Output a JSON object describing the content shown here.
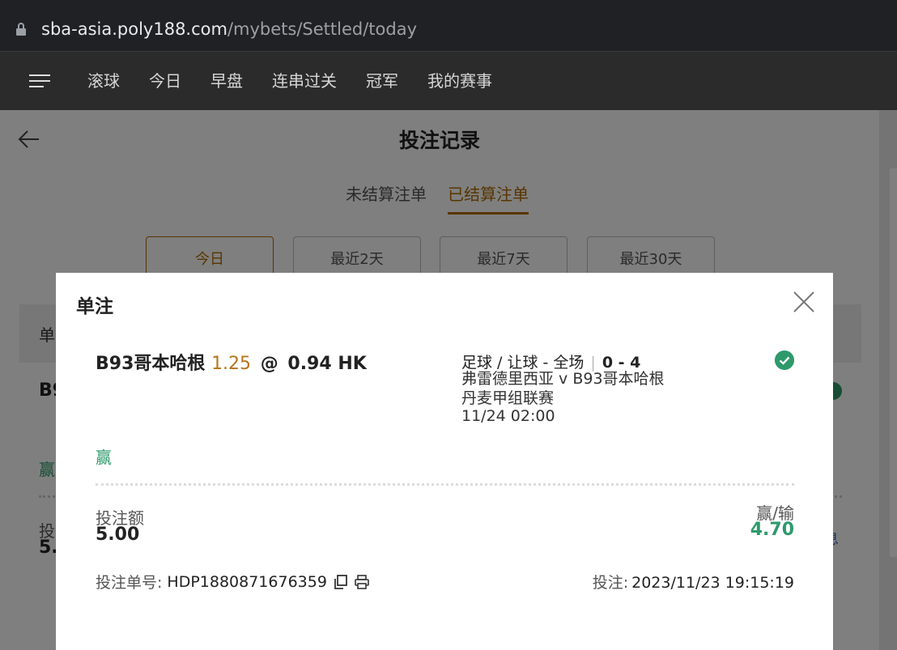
{
  "browser": {
    "url_host": "sba-asia.poly188.com",
    "url_path": "/mybets/Settled/today"
  },
  "nav": {
    "items": [
      "滚球",
      "今日",
      "早盘",
      "连串过关",
      "冠军",
      "我的赛事"
    ]
  },
  "page": {
    "title": "投注记录",
    "tabs": [
      "未结算注单",
      "已结算注单"
    ],
    "active_tab": 1,
    "date_filters": [
      "今日",
      "最近2天",
      "最近7天",
      "最近30天"
    ],
    "active_filter": 0,
    "list_header": "单",
    "bg_team_partial": "B9",
    "bg_result_partial": "赢",
    "bg_stake_label_partial": "投",
    "bg_stake_value_partial": "5.",
    "bg_link_partial": "息"
  },
  "modal": {
    "title": "单注",
    "bet": {
      "team": "B93哥本哈根",
      "handicap": "1.25",
      "at": "@",
      "odds": "0.94 HK"
    },
    "market": "足球 / 让球 - 全场",
    "score": "0 - 4",
    "match": "弗雷德里西亚 v B93哥本哈根",
    "league": "丹麦甲组联赛",
    "kickoff": "11/24 02:00",
    "result": "赢",
    "stake_label": "投注额",
    "stake_value": "5.00",
    "pl_label": "赢/输",
    "pl_value": "4.70",
    "ticket_label": "投注单号:",
    "ticket_no": "HDP1880871676359",
    "placed_label": "投注:",
    "placed_time": "2023/11/23 19:15:19"
  },
  "colors": {
    "accent": "#b36a00",
    "win": "#2e9a6b",
    "handicap": "#b8741a"
  }
}
